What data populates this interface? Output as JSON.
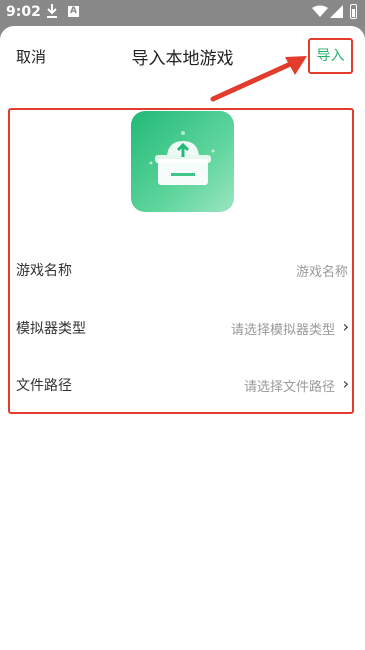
{
  "status_bar": {
    "time": "9:02",
    "icons": [
      "download-icon",
      "a-notification-icon",
      "wifi-icon",
      "signal-icon",
      "battery-icon"
    ],
    "a_glyph": "A"
  },
  "header": {
    "cancel_label": "取消",
    "title": "导入本地游戏",
    "import_label": "导入"
  },
  "form": {
    "icon_name": "game-box-upload-icon",
    "rows": [
      {
        "label": "游戏名称",
        "value": "游戏名称"
      },
      {
        "label": "模拟器类型",
        "value": "请选择模拟器类型"
      },
      {
        "label": "文件路径",
        "value": "请选择文件路径"
      }
    ]
  },
  "colors": {
    "accent_green": "#27b26a",
    "annotation_red": "#e23d2c"
  }
}
